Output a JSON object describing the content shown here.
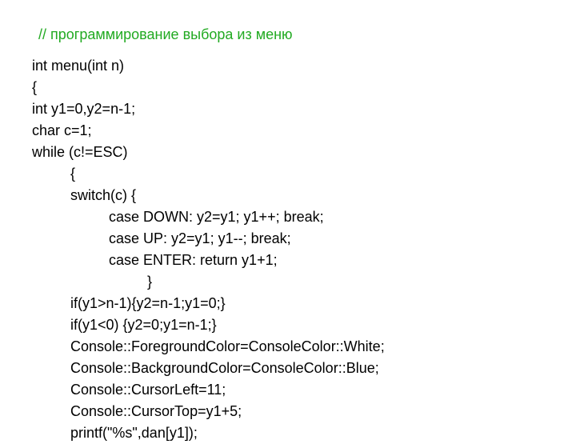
{
  "title": "// программирование выбора из меню",
  "code": {
    "l0": "int menu(int n)",
    "l1": "{",
    "l2": "int y1=0,y2=n-1;",
    "l3": "char c=1;",
    "l4": "while (c!=ESC)",
    "l5": "{",
    "l6": "switch(c) {",
    "l7": "case DOWN: y2=y1; y1++; break;",
    "l8": "case UP: y2=y1; y1--; break;",
    "l9": "case ENTER: return y1+1;",
    "l10": "}",
    "l11": "if(y1>n-1){y2=n-1;y1=0;}",
    "l12": "if(y1<0) {y2=0;y1=n-1;}",
    "l13": "Console::ForegroundColor=ConsoleColor::White;",
    "l14": "Console::BackgroundColor=ConsoleColor::Blue;",
    "l15": "Console::CursorLeft=11;",
    "l16": "Console::CursorTop=y1+5;",
    "l17": "printf(\"%s\",dan[y1]);"
  }
}
